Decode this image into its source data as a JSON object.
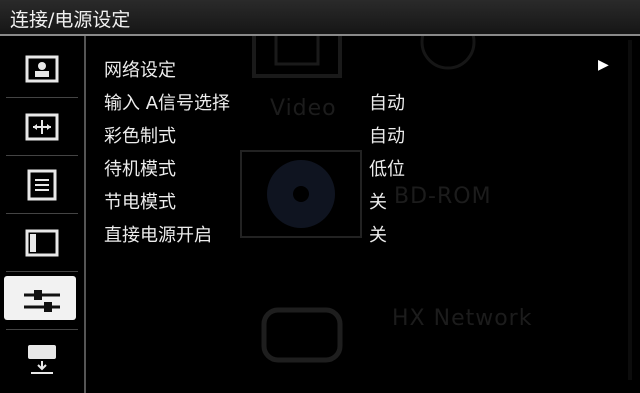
{
  "header": {
    "title": "连接/电源设定"
  },
  "sidebar": {
    "items": [
      {
        "icon": "picture-icon"
      },
      {
        "icon": "screen-adjust-icon"
      },
      {
        "icon": "list-icon"
      },
      {
        "icon": "film-icon"
      },
      {
        "icon": "connection-cable-icon",
        "active": true
      },
      {
        "icon": "download-icon"
      }
    ]
  },
  "menu": {
    "rows": [
      {
        "label": "网络设定",
        "value": "",
        "has_arrow": true
      },
      {
        "label": "输入 A信号选择",
        "value": "自动"
      },
      {
        "label": "彩色制式",
        "value": "自动"
      },
      {
        "label": "待机模式",
        "value": "低位"
      },
      {
        "label": "节电模式",
        "value": "关"
      },
      {
        "label": "直接电源开启",
        "value": "关"
      }
    ],
    "arrow": "▶"
  },
  "background": {
    "labels": [
      "Video",
      "BD-ROM",
      "HX Network"
    ]
  }
}
